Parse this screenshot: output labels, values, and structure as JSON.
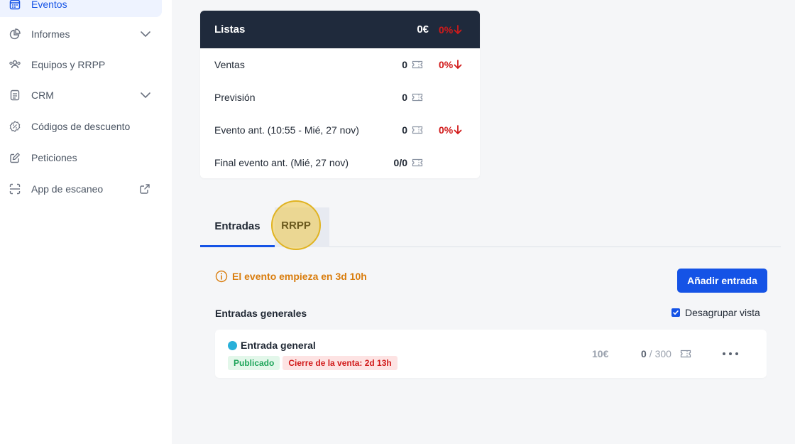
{
  "sidebar": {
    "items": [
      {
        "label": "Eventos",
        "icon": "calendar-icon",
        "active": true
      },
      {
        "label": "Informes",
        "icon": "chart-pie-icon",
        "chevron": true
      },
      {
        "label": "Equipos y RRPP",
        "icon": "users-icon"
      },
      {
        "label": "CRM",
        "icon": "document-icon",
        "chevron": true
      },
      {
        "label": "Códigos de descuento",
        "icon": "discount-badge-icon"
      },
      {
        "label": "Peticiones",
        "icon": "edit-icon"
      },
      {
        "label": "App de escaneo",
        "icon": "scan-icon",
        "external": true
      }
    ]
  },
  "stats": {
    "header": {
      "title": "Listas",
      "amount": "0€",
      "pct": "0%"
    },
    "rows": [
      {
        "label": "Ventas",
        "value": "0",
        "pct": "0%"
      },
      {
        "label": "Previsión",
        "value": "0",
        "pct": ""
      },
      {
        "label": "Evento ant. (10:55 - Mié, 27 nov)",
        "value": "0",
        "pct": "0%"
      },
      {
        "label": "Final evento ant. (Mié, 27 nov)",
        "value": "0/0",
        "pct": ""
      }
    ]
  },
  "tabs": [
    {
      "label": "Entradas",
      "active": true
    },
    {
      "label": "RRPP",
      "active": false
    }
  ],
  "info": {
    "text": "El evento empieza en 3d 10h"
  },
  "actions": {
    "add_ticket": "Añadir entrada"
  },
  "section": {
    "title": "Entradas generales",
    "ungroup_label": "Desagrupar vista",
    "ungroup_checked": true
  },
  "ticket": {
    "name": "Entrada general",
    "badges": [
      "Publicado",
      "Cierre de la venta: 2d 13h"
    ],
    "price": "10€",
    "sold": "0",
    "stock": "/ 300"
  },
  "colors": {
    "primary": "#1553e6",
    "header_bg": "#1f2a3c",
    "negative": "#d11a1a",
    "warning": "#d97d0e"
  }
}
